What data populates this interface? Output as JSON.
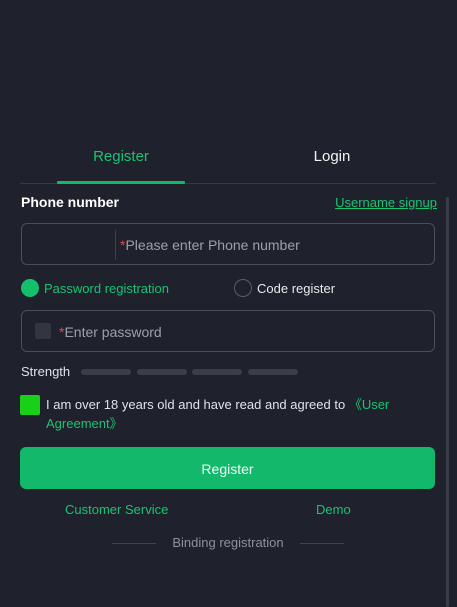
{
  "tabs": {
    "register": "Register",
    "login": "Login"
  },
  "phone": {
    "label": "Phone number",
    "username_link": "Username signup",
    "required_mark": "*",
    "placeholder": "Please enter Phone number"
  },
  "reg_method": {
    "password": "Password registration",
    "code": "Code register",
    "selected": "password"
  },
  "password": {
    "required_mark": "*",
    "placeholder": "Enter password"
  },
  "strength": {
    "label": "Strength",
    "level": 0
  },
  "agreement": {
    "text": "I am over 18 years old and have read and agreed to ",
    "link": "《User Agreement》",
    "checked": true
  },
  "actions": {
    "register": "Register",
    "customer_service": "Customer Service",
    "demo": "Demo",
    "binding": "Binding registration"
  },
  "colors": {
    "accent": "#12b96b",
    "background": "#1f222c",
    "checkbox": "#18d018"
  }
}
